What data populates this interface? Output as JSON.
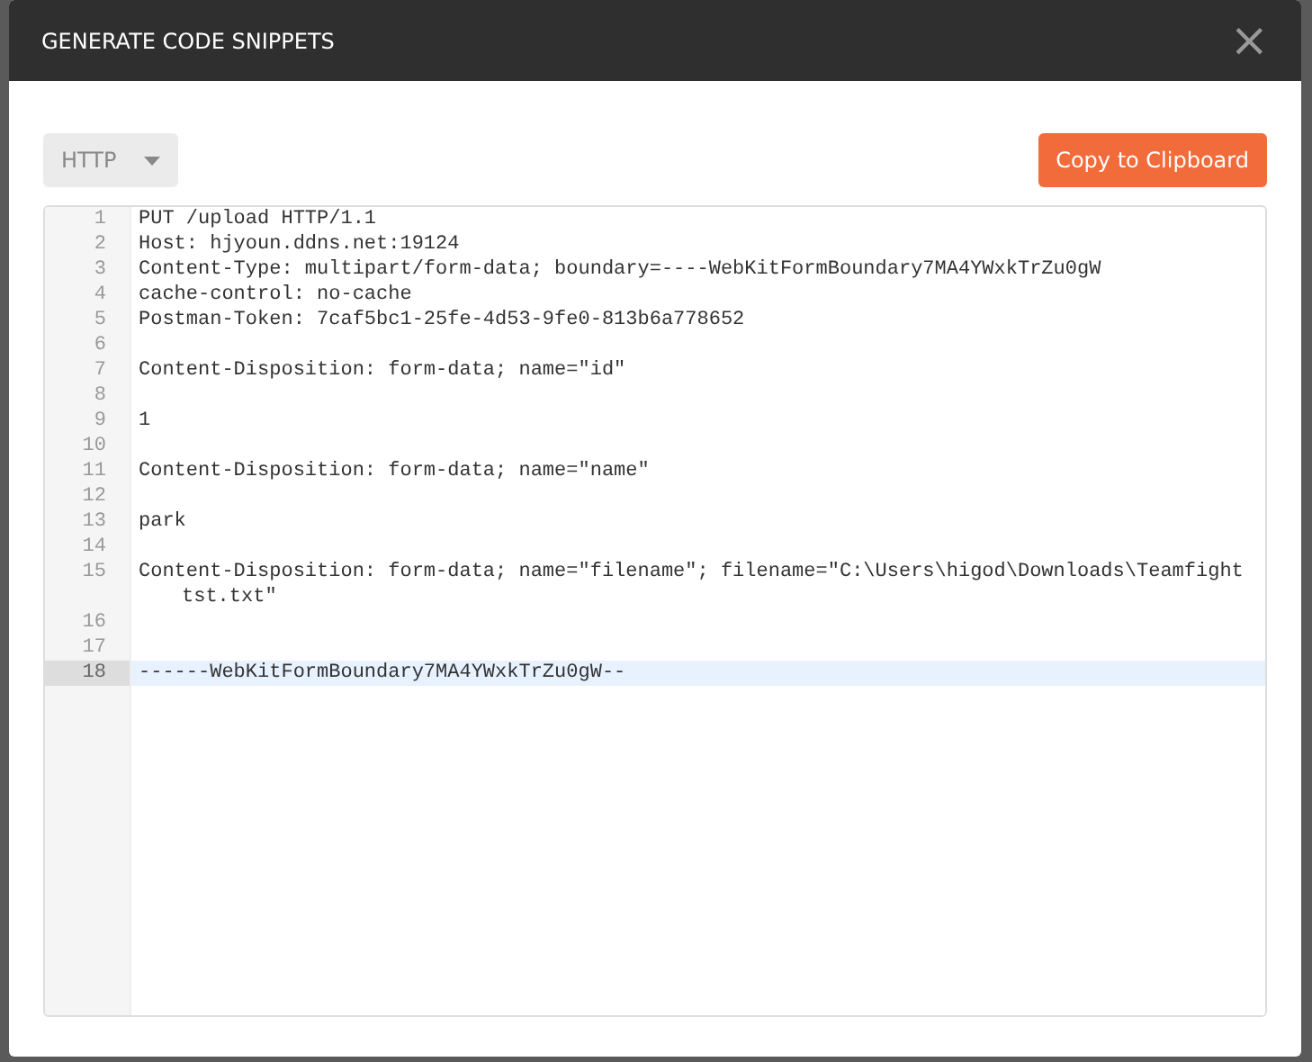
{
  "dialog": {
    "title": "GENERATE CODE SNIPPETS",
    "close": "×"
  },
  "language_select": {
    "value": "HTTP"
  },
  "copy_button": "Copy to Clipboard",
  "code_lines": [
    {
      "number": "1",
      "text": "PUT /upload HTTP/1.1",
      "active": false
    },
    {
      "number": "2",
      "text": "Host: hjyoun.ddns.net:19124",
      "active": false
    },
    {
      "number": "3",
      "text": "Content-Type: multipart/form-data; boundary=----WebKitFormBoundary7MA4YWxkTrZu0gW",
      "active": false
    },
    {
      "number": "4",
      "text": "cache-control: no-cache",
      "active": false
    },
    {
      "number": "5",
      "text": "Postman-Token: 7caf5bc1-25fe-4d53-9fe0-813b6a778652",
      "active": false
    },
    {
      "number": "6",
      "active": false
    },
    {
      "number": "7",
      "text": "Content-Disposition: form-data; name=\"id\"",
      "active": false
    },
    {
      "number": "8",
      "active": false
    },
    {
      "number": "9",
      "text": "1",
      "active": false
    },
    {
      "number": "10",
      "active": false
    },
    {
      "number": "11",
      "text": "Content-Disposition: form-data; name=\"name\"",
      "active": false
    },
    {
      "number": "12",
      "active": false
    },
    {
      "number": "13",
      "text": "park",
      "active": false
    },
    {
      "number": "14",
      "active": false
    },
    {
      "number": "15",
      "text": "Content-Disposition: form-data; name=\"filename\"; filename=\"C:\\Users\\higod\\Downloads\\Teamfight tst.txt\"",
      "active": false
    },
    {
      "number": "16",
      "active": false
    },
    {
      "number": "17",
      "active": false
    },
    {
      "number": "18",
      "text": "------WebKitFormBoundary7MA4YWxkTrZu0gW--",
      "active": true
    }
  ]
}
